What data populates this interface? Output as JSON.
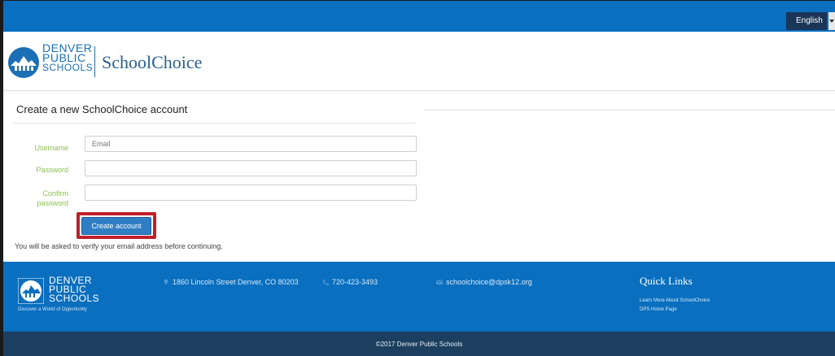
{
  "topbar": {
    "language": "English"
  },
  "header": {
    "logo_lines": [
      "DENVER",
      "PUBLIC",
      "SCHOOLS"
    ],
    "brand": "SchoolChoice"
  },
  "form": {
    "title": "Create a new SchoolChoice account",
    "username_label": "Username",
    "username_placeholder": "Email",
    "password_label": "Password",
    "confirm_label_1": "Confirm",
    "confirm_label_2": "password",
    "submit_label": "Create account",
    "note": "You will be asked to verify your email address before continuing."
  },
  "footer": {
    "logo_lines": [
      "DENVER",
      "PUBLIC",
      "SCHOOLS"
    ],
    "tagline": "Discover a World of Opportunity",
    "address": "1860 Lincoln Street Denver, CO 80203",
    "phone": "720-423-3493",
    "email": "schoolchoice@dpsk12.org",
    "quick_links_title": "Quick Links",
    "links": [
      "Learn More About SchoolChoice",
      "DPS Home Page"
    ],
    "copyright": "©2017 Denver Public Schools"
  },
  "colors": {
    "primary_blue": "#0a6fbf",
    "dark_navy": "#1d3f5f",
    "label_green": "#8cc152",
    "highlight_red": "#c0202a"
  }
}
